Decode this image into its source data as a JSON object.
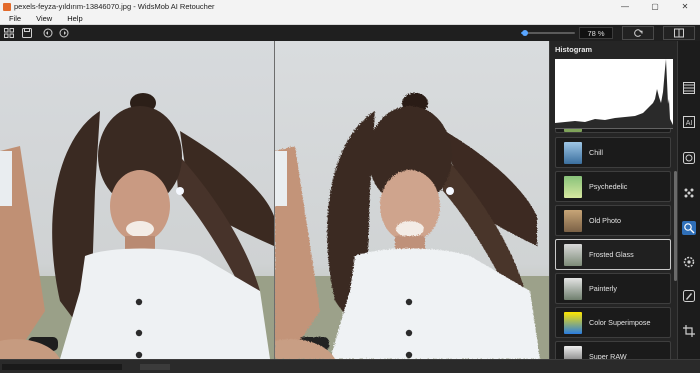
{
  "window": {
    "title": "pexels-feyza-yıldırım-13846070.jpg - WidsMob AI Retoucher",
    "controls": {
      "minimize": "—",
      "maximize": "▢",
      "close": "✕"
    }
  },
  "menu": {
    "items": [
      "File",
      "View",
      "Help"
    ]
  },
  "toolbar": {
    "zoom_value": "78 %",
    "zoom_level": 0.08,
    "icons": [
      "grid-icon",
      "save-icon",
      "rotate-left-icon",
      "rotate-right-icon",
      "reset-icon",
      "compare-icon"
    ]
  },
  "panel": {
    "title": "Histogram",
    "filters": [
      {
        "label": "Chill",
        "colors": [
          "#9fc7e6",
          "#3b6f9e"
        ]
      },
      {
        "label": "Psychedelic",
        "colors": [
          "#88c27a",
          "#d7e8a0"
        ]
      },
      {
        "label": "Old Photo",
        "colors": [
          "#c7a577",
          "#7b6146"
        ]
      },
      {
        "label": "Frosted Glass",
        "colors": [
          "#d9d9d9",
          "#7d8b78"
        ],
        "active": true
      },
      {
        "label": "Painterly",
        "colors": [
          "#e4e4e4",
          "#6f7f6e"
        ]
      },
      {
        "label": "Color Superimpose",
        "colors": [
          "#ffe600",
          "#2a7de1"
        ]
      },
      {
        "label": "Super RAW",
        "colors": [
          "#eeeeee",
          "#555555"
        ]
      }
    ]
  },
  "colors": {
    "accent": "#3a8ee6",
    "panel_bg": "#252525",
    "selected_tool": "#2f6fb8"
  }
}
